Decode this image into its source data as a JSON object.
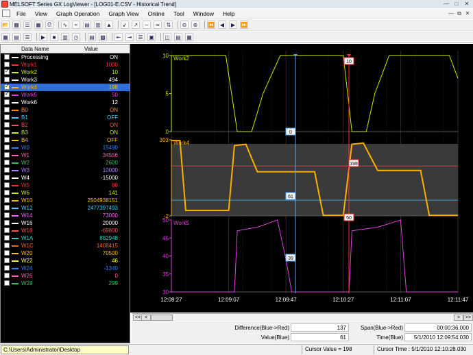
{
  "window": {
    "title": "MELSOFT Series GX LogViewer - [LOG01-E.CSV - Historical Trend]"
  },
  "menu": [
    "File",
    "View",
    "Graph Operation",
    "Graph View",
    "Online",
    "Tool",
    "Window",
    "Help"
  ],
  "list": {
    "headers": {
      "name": "Data Name",
      "value": "Value"
    },
    "rows": [
      {
        "name": "Processing",
        "value": "ON",
        "color": "#ffffff",
        "checked": false
      },
      {
        "name": "Work1",
        "value": "1000",
        "color": "#ff3030",
        "checked": false
      },
      {
        "name": "Work2",
        "value": "10",
        "color": "#c8f000",
        "checked": true
      },
      {
        "name": "Work3",
        "value": "494",
        "color": "#ffffff",
        "checked": false
      },
      {
        "name": "Work4",
        "value": "198",
        "color": "#ffb000",
        "checked": true,
        "selected": true
      },
      {
        "name": "Work5",
        "value": "50",
        "color": "#e040e0",
        "checked": true
      },
      {
        "name": "Work6",
        "value": "12",
        "color": "#ffffff",
        "checked": false
      },
      {
        "name": "B0",
        "value": "ON",
        "color": "#ff9020",
        "checked": false
      },
      {
        "name": "B1",
        "value": "OFF",
        "color": "#40d0ff",
        "checked": false
      },
      {
        "name": "B2",
        "value": "ON",
        "color": "#ff5050",
        "checked": false
      },
      {
        "name": "B3",
        "value": "ON",
        "color": "#c8f000",
        "checked": false
      },
      {
        "name": "B4",
        "value": "OFF",
        "color": "#ffc000",
        "checked": false
      },
      {
        "name": "W0",
        "value": "15490",
        "color": "#3080ff",
        "checked": false
      },
      {
        "name": "W1",
        "value": "34556",
        "color": "#ff60b0",
        "checked": false
      },
      {
        "name": "W2",
        "value": "2600",
        "color": "#30c060",
        "checked": false
      },
      {
        "name": "W3",
        "value": "10000",
        "color": "#b080ff",
        "checked": false
      },
      {
        "name": "W4",
        "value": "-15000",
        "color": "#ffffff",
        "checked": false
      },
      {
        "name": "W5",
        "value": "88",
        "color": "#ff3030",
        "checked": false
      },
      {
        "name": "W6",
        "value": "141",
        "color": "#c8f000",
        "checked": false
      },
      {
        "name": "W10",
        "value": "2504938151",
        "color": "#ffc000",
        "checked": false
      },
      {
        "name": "W12",
        "value": "2477397493",
        "color": "#40d0ff",
        "checked": false
      },
      {
        "name": "W14",
        "value": "73000",
        "color": "#ff60ff",
        "checked": false
      },
      {
        "name": "W16",
        "value": "20000",
        "color": "#ffffff",
        "checked": false
      },
      {
        "name": "W18",
        "value": "-69800",
        "color": "#ff5050",
        "checked": false
      },
      {
        "name": "W1A",
        "value": "882948",
        "color": "#30d0c0",
        "checked": false
      },
      {
        "name": "W1C",
        "value": "1408415",
        "color": "#ff6020",
        "checked": false
      },
      {
        "name": "W20",
        "value": "70500",
        "color": "#ffc000",
        "checked": false
      },
      {
        "name": "W22",
        "value": "46",
        "color": "#ffff60",
        "checked": false
      },
      {
        "name": "W24",
        "value": "-1340",
        "color": "#3080ff",
        "checked": false
      },
      {
        "name": "W26",
        "value": "0",
        "color": "#ff60b0",
        "checked": false
      },
      {
        "name": "W28",
        "value": "299",
        "color": "#30c060",
        "checked": false
      }
    ]
  },
  "chart_data": {
    "type": "line",
    "x_ticks": [
      "12:08:27",
      "12:09:07",
      "12:09:47",
      "12:10:27",
      "12:11:07",
      "12:11:47"
    ],
    "cursor_red_label": "10",
    "panels": [
      {
        "name": "Work2",
        "color": "#c8f000",
        "ylim": [
          0,
          10
        ],
        "ticks": [
          "10",
          "5",
          "0"
        ],
        "cursor_blue_value": "0",
        "points": [
          [
            0,
            10
          ],
          [
            0.19,
            10
          ],
          [
            0.23,
            0
          ],
          [
            0.28,
            0
          ],
          [
            0.32,
            5
          ],
          [
            0.38,
            10
          ],
          [
            0.6,
            10
          ],
          [
            0.63,
            0
          ],
          [
            0.68,
            0
          ],
          [
            0.71,
            5
          ],
          [
            0.76,
            10
          ],
          [
            0.97,
            10
          ],
          [
            1,
            7
          ]
        ]
      },
      {
        "name": "Work4",
        "color": "#ffb000",
        "ylim": [
          -2,
          303
        ],
        "ticks": [
          "303",
          "-2"
        ],
        "cursor_blue_value": "61",
        "cursor_red_value": "198",
        "hline_red": 198,
        "hline_blue": 61,
        "cursor_red_bottom": "50",
        "points": [
          [
            0,
            300
          ],
          [
            0.03,
            300
          ],
          [
            0.05,
            20
          ],
          [
            0.2,
            20
          ],
          [
            0.22,
            280
          ],
          [
            0.26,
            285
          ],
          [
            0.3,
            175
          ],
          [
            0.5,
            175
          ],
          [
            0.53,
            0
          ],
          [
            0.6,
            0
          ],
          [
            0.63,
            285
          ],
          [
            0.67,
            290
          ],
          [
            0.72,
            180
          ],
          [
            0.87,
            180
          ],
          [
            0.9,
            0
          ],
          [
            1,
            0
          ]
        ]
      },
      {
        "name": "Work5",
        "color": "#e040e0",
        "ylim": [
          30,
          50
        ],
        "ticks": [
          "50",
          "45",
          "40",
          "35",
          "30"
        ],
        "cursor_blue_value": "39",
        "points": [
          [
            0,
            30
          ],
          [
            0.22,
            30
          ],
          [
            0.23,
            47
          ],
          [
            0.3,
            48
          ],
          [
            0.37,
            50
          ],
          [
            0.4,
            39
          ],
          [
            0.42,
            30
          ],
          [
            0.62,
            30
          ],
          [
            0.63,
            47
          ],
          [
            0.72,
            48
          ],
          [
            0.8,
            50
          ],
          [
            0.82,
            30
          ],
          [
            1,
            30
          ]
        ]
      }
    ]
  },
  "info": {
    "diff_label": "Difference(Blue->Red)",
    "diff_value": "137",
    "span_label": "Span(Blue->Red)",
    "span_value": "00:00:36.000",
    "value_label": "Value(Blue)",
    "value_value": "61",
    "time_label": "Time(Blue)",
    "time_value": "5/1/2010 12:09:54.030"
  },
  "status": {
    "path": "C:\\Users\\Administrator\\Desktop",
    "cursor_value": "Cursor Value = 198",
    "cursor_time": "Cursor Time : 5/1/2010 12:10:28.030"
  }
}
